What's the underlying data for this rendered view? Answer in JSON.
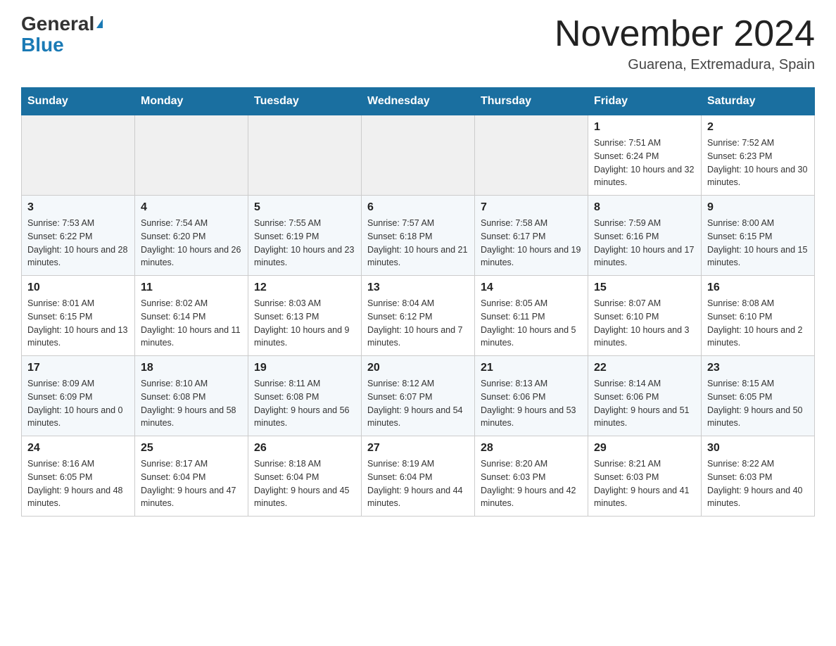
{
  "header": {
    "logo_general": "General",
    "logo_blue": "Blue",
    "month_title": "November 2024",
    "location": "Guarena, Extremadura, Spain"
  },
  "columns": [
    "Sunday",
    "Monday",
    "Tuesday",
    "Wednesday",
    "Thursday",
    "Friday",
    "Saturday"
  ],
  "weeks": [
    [
      {
        "day": "",
        "info": ""
      },
      {
        "day": "",
        "info": ""
      },
      {
        "day": "",
        "info": ""
      },
      {
        "day": "",
        "info": ""
      },
      {
        "day": "",
        "info": ""
      },
      {
        "day": "1",
        "info": "Sunrise: 7:51 AM\nSunset: 6:24 PM\nDaylight: 10 hours and 32 minutes."
      },
      {
        "day": "2",
        "info": "Sunrise: 7:52 AM\nSunset: 6:23 PM\nDaylight: 10 hours and 30 minutes."
      }
    ],
    [
      {
        "day": "3",
        "info": "Sunrise: 7:53 AM\nSunset: 6:22 PM\nDaylight: 10 hours and 28 minutes."
      },
      {
        "day": "4",
        "info": "Sunrise: 7:54 AM\nSunset: 6:20 PM\nDaylight: 10 hours and 26 minutes."
      },
      {
        "day": "5",
        "info": "Sunrise: 7:55 AM\nSunset: 6:19 PM\nDaylight: 10 hours and 23 minutes."
      },
      {
        "day": "6",
        "info": "Sunrise: 7:57 AM\nSunset: 6:18 PM\nDaylight: 10 hours and 21 minutes."
      },
      {
        "day": "7",
        "info": "Sunrise: 7:58 AM\nSunset: 6:17 PM\nDaylight: 10 hours and 19 minutes."
      },
      {
        "day": "8",
        "info": "Sunrise: 7:59 AM\nSunset: 6:16 PM\nDaylight: 10 hours and 17 minutes."
      },
      {
        "day": "9",
        "info": "Sunrise: 8:00 AM\nSunset: 6:15 PM\nDaylight: 10 hours and 15 minutes."
      }
    ],
    [
      {
        "day": "10",
        "info": "Sunrise: 8:01 AM\nSunset: 6:15 PM\nDaylight: 10 hours and 13 minutes."
      },
      {
        "day": "11",
        "info": "Sunrise: 8:02 AM\nSunset: 6:14 PM\nDaylight: 10 hours and 11 minutes."
      },
      {
        "day": "12",
        "info": "Sunrise: 8:03 AM\nSunset: 6:13 PM\nDaylight: 10 hours and 9 minutes."
      },
      {
        "day": "13",
        "info": "Sunrise: 8:04 AM\nSunset: 6:12 PM\nDaylight: 10 hours and 7 minutes."
      },
      {
        "day": "14",
        "info": "Sunrise: 8:05 AM\nSunset: 6:11 PM\nDaylight: 10 hours and 5 minutes."
      },
      {
        "day": "15",
        "info": "Sunrise: 8:07 AM\nSunset: 6:10 PM\nDaylight: 10 hours and 3 minutes."
      },
      {
        "day": "16",
        "info": "Sunrise: 8:08 AM\nSunset: 6:10 PM\nDaylight: 10 hours and 2 minutes."
      }
    ],
    [
      {
        "day": "17",
        "info": "Sunrise: 8:09 AM\nSunset: 6:09 PM\nDaylight: 10 hours and 0 minutes."
      },
      {
        "day": "18",
        "info": "Sunrise: 8:10 AM\nSunset: 6:08 PM\nDaylight: 9 hours and 58 minutes."
      },
      {
        "day": "19",
        "info": "Sunrise: 8:11 AM\nSunset: 6:08 PM\nDaylight: 9 hours and 56 minutes."
      },
      {
        "day": "20",
        "info": "Sunrise: 8:12 AM\nSunset: 6:07 PM\nDaylight: 9 hours and 54 minutes."
      },
      {
        "day": "21",
        "info": "Sunrise: 8:13 AM\nSunset: 6:06 PM\nDaylight: 9 hours and 53 minutes."
      },
      {
        "day": "22",
        "info": "Sunrise: 8:14 AM\nSunset: 6:06 PM\nDaylight: 9 hours and 51 minutes."
      },
      {
        "day": "23",
        "info": "Sunrise: 8:15 AM\nSunset: 6:05 PM\nDaylight: 9 hours and 50 minutes."
      }
    ],
    [
      {
        "day": "24",
        "info": "Sunrise: 8:16 AM\nSunset: 6:05 PM\nDaylight: 9 hours and 48 minutes."
      },
      {
        "day": "25",
        "info": "Sunrise: 8:17 AM\nSunset: 6:04 PM\nDaylight: 9 hours and 47 minutes."
      },
      {
        "day": "26",
        "info": "Sunrise: 8:18 AM\nSunset: 6:04 PM\nDaylight: 9 hours and 45 minutes."
      },
      {
        "day": "27",
        "info": "Sunrise: 8:19 AM\nSunset: 6:04 PM\nDaylight: 9 hours and 44 minutes."
      },
      {
        "day": "28",
        "info": "Sunrise: 8:20 AM\nSunset: 6:03 PM\nDaylight: 9 hours and 42 minutes."
      },
      {
        "day": "29",
        "info": "Sunrise: 8:21 AM\nSunset: 6:03 PM\nDaylight: 9 hours and 41 minutes."
      },
      {
        "day": "30",
        "info": "Sunrise: 8:22 AM\nSunset: 6:03 PM\nDaylight: 9 hours and 40 minutes."
      }
    ]
  ]
}
